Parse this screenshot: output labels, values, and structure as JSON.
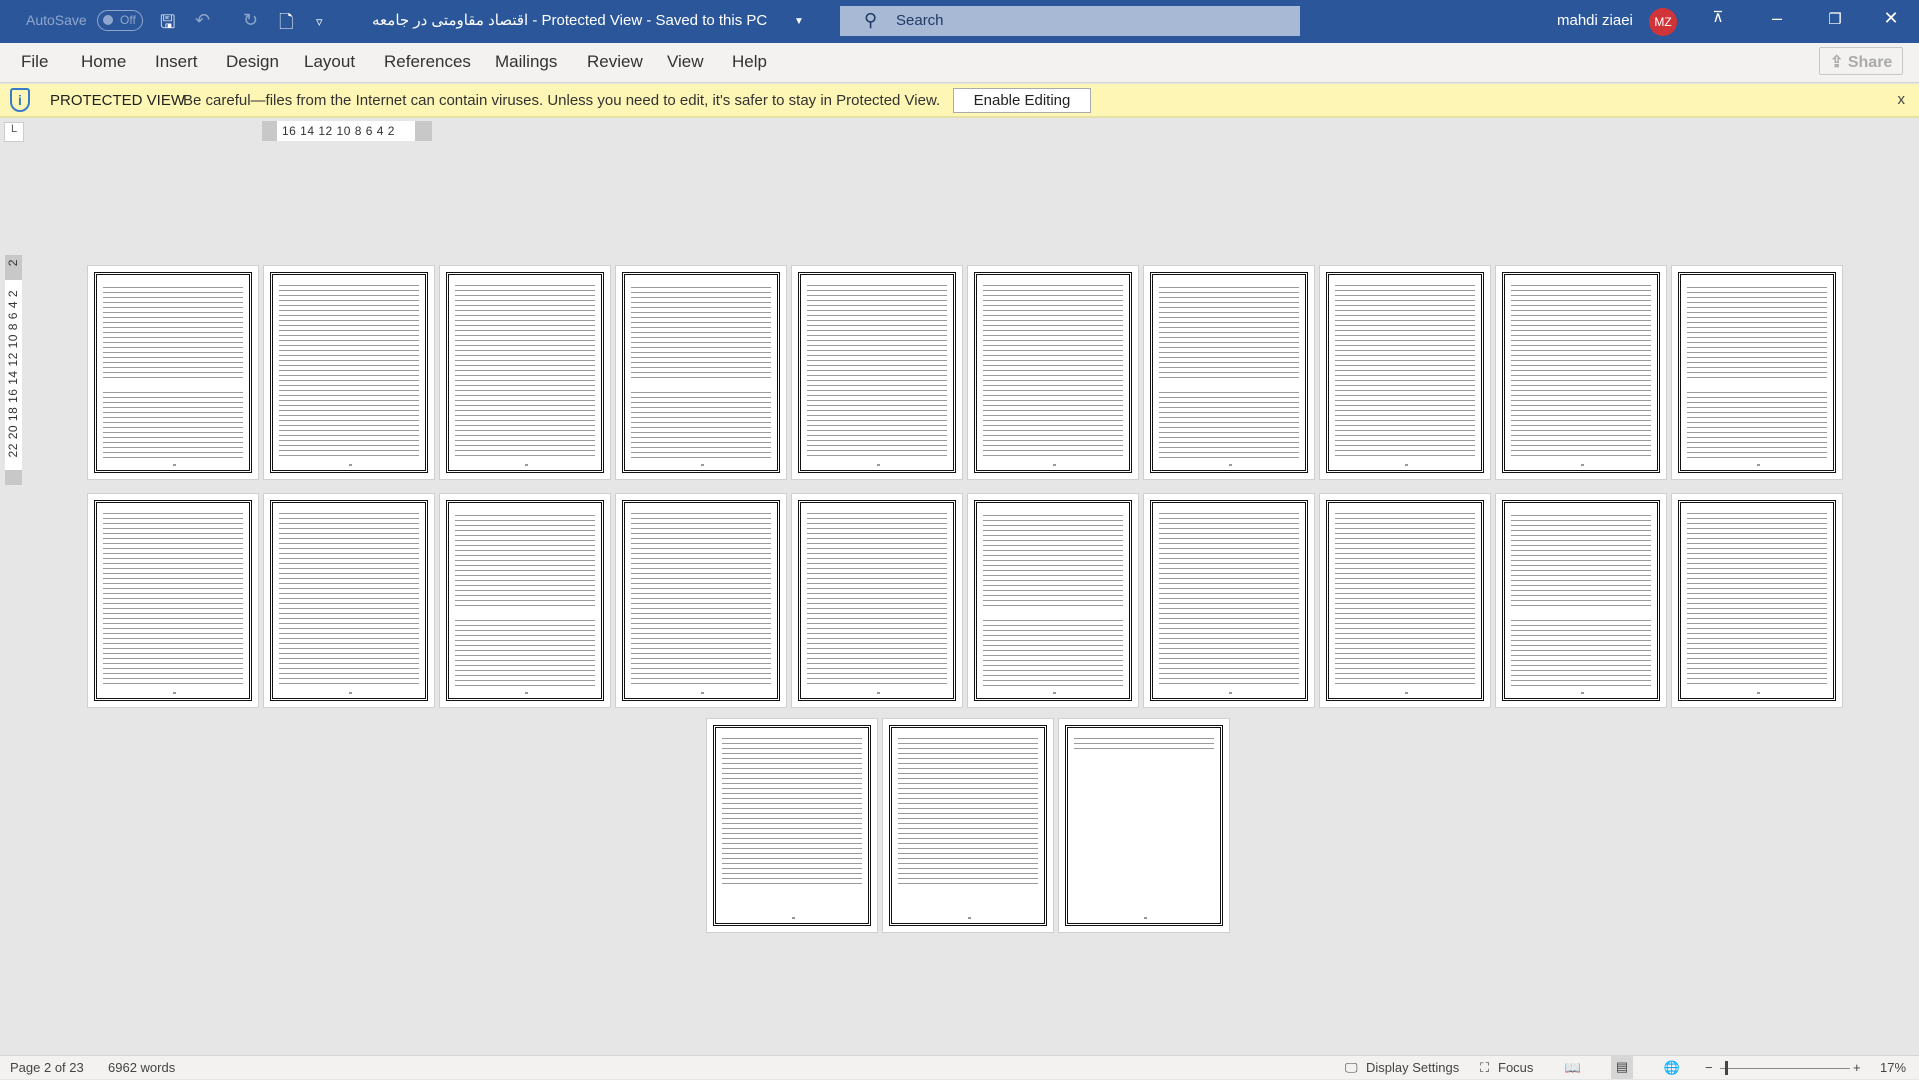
{
  "titlebar": {
    "autosave_label": "AutoSave",
    "autosave_state": "Off",
    "document_title": "اقتصاد مقاومتی در جامعه  -  Protected View  -  Saved to this PC",
    "search_placeholder": "Search",
    "user_name": "mahdi ziaei",
    "user_initials": "MZ",
    "avatar_color": "#d13438",
    "accent_color": "#2b579a"
  },
  "ribbon": {
    "tabs": [
      "File",
      "Home",
      "Insert",
      "Design",
      "Layout",
      "References",
      "Mailings",
      "Review",
      "View",
      "Help"
    ],
    "share_label": "Share"
  },
  "protected_view": {
    "label": "PROTECTED VIEW",
    "message": "Be careful—files from the Internet can contain viruses. Unless you need to edit, it's safer to stay in Protected View.",
    "enable_button": "Enable Editing",
    "close": "x"
  },
  "rulers": {
    "horizontal": "16 14 12 10  8   6   4   2",
    "vertical": "22 20 18 16 14 12 10  8   6   4   2",
    "vertical_top": "2",
    "corner": "L"
  },
  "status": {
    "page": "Page 2 of 23",
    "page_count": 23,
    "words": "6962 words",
    "display_settings": "Display Settings",
    "focus": "Focus",
    "zoom": "17%"
  }
}
